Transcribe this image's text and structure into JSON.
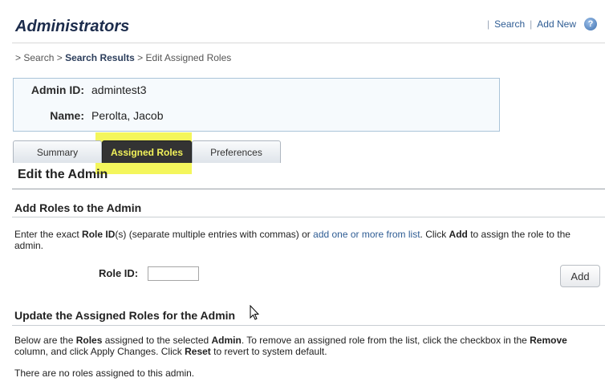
{
  "header": {
    "title": "Administrators",
    "links": [
      "Search",
      "Add New"
    ],
    "help_icon_glyph": "?"
  },
  "breadcrumb": {
    "items": [
      "Search",
      "Search Results",
      "Edit Assigned Roles"
    ],
    "sep": ">"
  },
  "admin_info": {
    "id_label": "Admin ID:",
    "id_value": "admintest3",
    "name_label": "Name:",
    "name_value": "Perolta, Jacob"
  },
  "tabs": [
    {
      "label": "Summary",
      "active": false
    },
    {
      "label": "Assigned Roles",
      "active": true
    },
    {
      "label": "Preferences",
      "active": false
    }
  ],
  "section_title": "Edit the Admin",
  "add_roles": {
    "title": "Add Roles to the Admin",
    "desc_1": "Enter the exact ",
    "desc_bold_1": "Role ID",
    "desc_2": "(s) (separate multiple entries with commas) or ",
    "desc_link": "add one or more from list",
    "desc_3": ". Click ",
    "desc_bold_2": "Add",
    "desc_4": " to assign the role to the admin.",
    "role_label": "Role ID:",
    "role_value": "",
    "add_button": "Add"
  },
  "update_roles": {
    "title": "Update the Assigned Roles for the Admin",
    "desc_1": "Below are the ",
    "desc_bold_1": "Roles",
    "desc_2": " assigned to the selected ",
    "desc_bold_2": "Admin",
    "desc_3": ". To remove an assigned role from the list, click the checkbox in the ",
    "desc_bold_3": "Remove",
    "desc_4": " column, and click Apply Changes. Click ",
    "desc_bold_4": "Reset",
    "desc_5": " to revert to system default.",
    "empty_message": "There are no roles assigned to this admin."
  },
  "colors": {
    "title": "#1c2c4c",
    "link": "#2f5d94",
    "active_tab_bg": "#333333",
    "active_tab_text": "#f2f25a",
    "highlight": "#f2f540"
  }
}
